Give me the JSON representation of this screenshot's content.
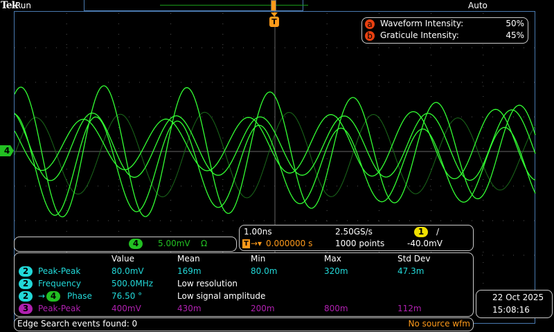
{
  "header": {
    "logo": "Tek",
    "status": "Run",
    "trigger_mode": "Auto"
  },
  "intensity": {
    "waveform_label": "Waveform Intensity:",
    "waveform_value": "50%",
    "graticule_label": "Graticule Intensity:",
    "graticule_value": "45%",
    "badge_a": "a",
    "badge_b": "b"
  },
  "channel": {
    "number": "4",
    "scale": "5.00mV",
    "coupling": "Ω",
    "color": "#22c022"
  },
  "timebase": {
    "horizontal": "1.00ns",
    "sample_rate": "2.50GS/s",
    "trigger_channel": "1",
    "trigger_slope": "/",
    "trigger_position": "0.000000 s",
    "record_length": "1000 points",
    "trigger_level": "-40.0mV"
  },
  "measurements": {
    "headers": [
      "Value",
      "Mean",
      "Min",
      "Max",
      "Std Dev"
    ],
    "rows": [
      {
        "ch": "2",
        "name": "Peak-Peak",
        "cells": [
          "80.0mV",
          "169m",
          "80.0m",
          "320m",
          "47.3m"
        ],
        "color": "#22d8d8"
      },
      {
        "ch": "2",
        "name": "Frequency",
        "cells": [
          "500.0MHz",
          "Low resolution"
        ],
        "color": "#22d8d8"
      },
      {
        "ch": "2",
        "ch2": "4",
        "name": "Phase",
        "cells": [
          "76.50 °",
          "Low signal amplitude"
        ],
        "color": "#22d8d8"
      },
      {
        "ch": "3",
        "name": "Peak-Peak",
        "cells": [
          "400mV",
          "430m",
          "200m",
          "800m",
          "112m"
        ],
        "color": "#b020b0"
      }
    ]
  },
  "search": {
    "status": "Edge Search events found: 0",
    "source": "No source wfm"
  },
  "datetime": {
    "date": "22 Oct  2025",
    "time": "15:08:16"
  },
  "colors": {
    "trace": "#33ff33",
    "trace_dim": "#1a6a1a",
    "trigger": "#ff9a1a",
    "border": "#4a7ab0"
  }
}
